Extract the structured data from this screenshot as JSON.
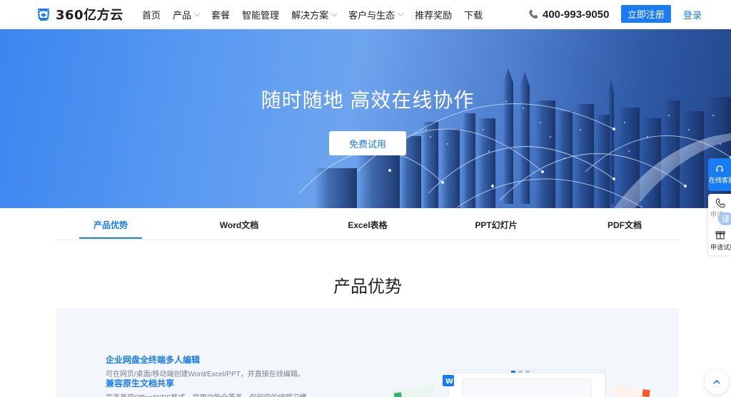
{
  "header": {
    "logo_text": "360亿方云",
    "nav": [
      {
        "label": "首页",
        "has_dropdown": false
      },
      {
        "label": "产品",
        "has_dropdown": true
      },
      {
        "label": "套餐",
        "has_dropdown": false
      },
      {
        "label": "智能管理",
        "has_dropdown": false
      },
      {
        "label": "解决方案",
        "has_dropdown": true
      },
      {
        "label": "客户与生态",
        "has_dropdown": true
      },
      {
        "label": "推荐奖励",
        "has_dropdown": false
      },
      {
        "label": "下载",
        "has_dropdown": false
      }
    ],
    "phone": "400-993-9050",
    "register_label": "立即注册",
    "login_label": "登录"
  },
  "banner": {
    "title": "随时随地 高效在线协作",
    "trial_label": "免费试用"
  },
  "tabs": [
    {
      "label": "产品优势",
      "active": true
    },
    {
      "label": "Word文档",
      "active": false
    },
    {
      "label": "Excel表格",
      "active": false
    },
    {
      "label": "PPT幻灯片",
      "active": false
    },
    {
      "label": "PDF文档",
      "active": false
    }
  ],
  "section": {
    "title": "产品优势",
    "features": [
      {
        "title": "企业网盘全终端多人编辑",
        "desc": "可在网页/桌面/移动端创建Word/Excel/PPT，并直接在线编辑。"
      },
      {
        "title": "兼容原生文档共享",
        "desc": "完美兼容Office/WPS格式，常用功能全覆盖，保留您的编辑习惯。"
      }
    ]
  },
  "side": {
    "cs_label": "在线客服",
    "phone_label": "申请",
    "trial_label": "申请试用",
    "badge": "译"
  },
  "colors": {
    "primary": "#1a7cf2",
    "text": "#222222",
    "panel_bg": "#f3f6fa"
  }
}
